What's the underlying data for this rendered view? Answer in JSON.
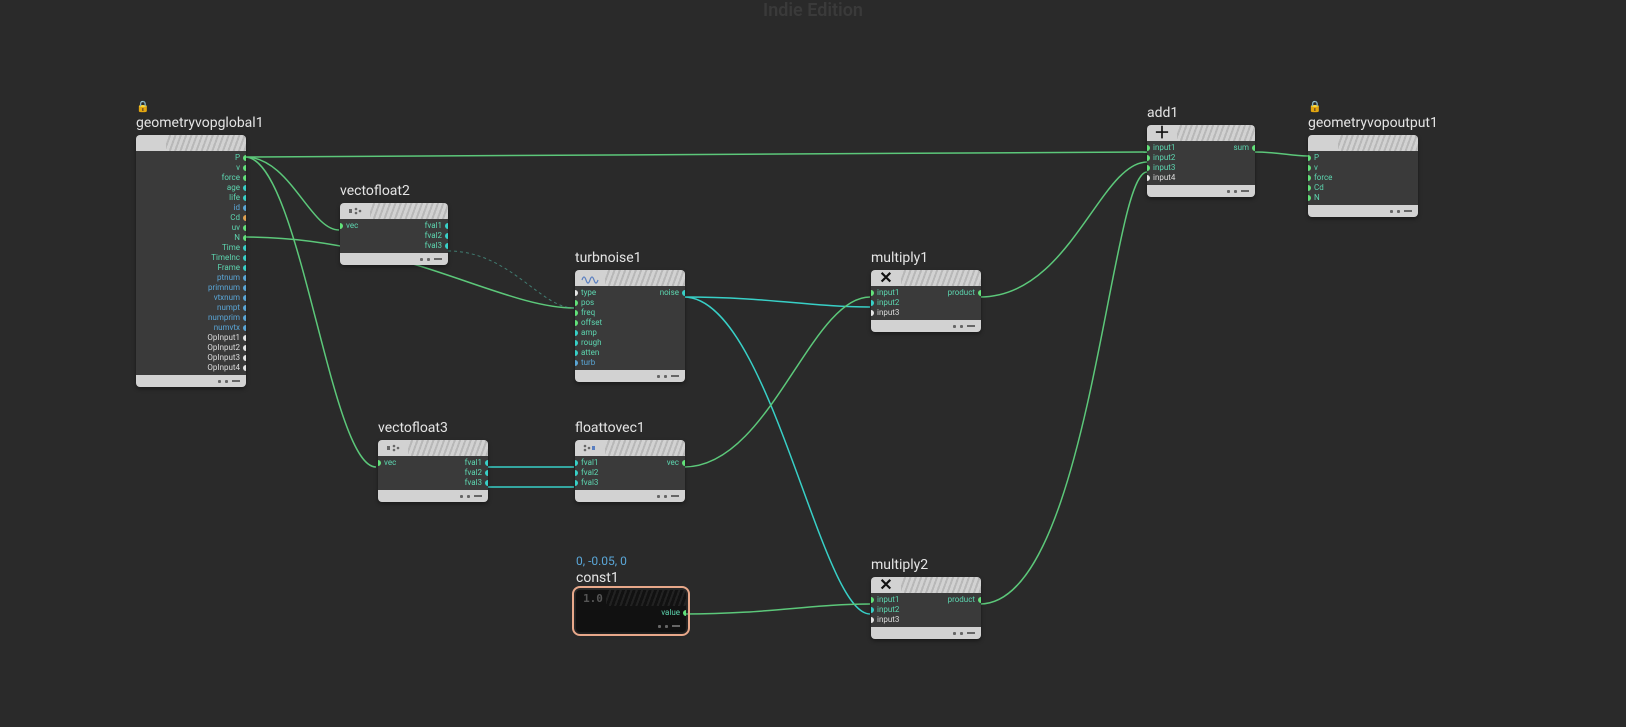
{
  "watermark": "Indie Edition",
  "nodes": {
    "geometryvopglobal1": {
      "title": "geometryvopglobal1",
      "locked": true,
      "outputs": [
        {
          "label": "P",
          "color": "green"
        },
        {
          "label": "v",
          "color": "green"
        },
        {
          "label": "force",
          "color": "green"
        },
        {
          "label": "age",
          "color": "teal"
        },
        {
          "label": "life",
          "color": "teal"
        },
        {
          "label": "id",
          "color": "blue"
        },
        {
          "label": "Cd",
          "color": "orange"
        },
        {
          "label": "uv",
          "color": "green"
        },
        {
          "label": "N",
          "color": "green"
        },
        {
          "label": "Time",
          "color": "teal"
        },
        {
          "label": "TimeInc",
          "color": "teal"
        },
        {
          "label": "Frame",
          "color": "teal"
        },
        {
          "label": "ptnum",
          "color": "blue"
        },
        {
          "label": "primnum",
          "color": "blue"
        },
        {
          "label": "vtxnum",
          "color": "blue"
        },
        {
          "label": "numpt",
          "color": "blue"
        },
        {
          "label": "numprim",
          "color": "blue"
        },
        {
          "label": "numvtx",
          "color": "blue"
        },
        {
          "label": "OpInput1",
          "color": "white"
        },
        {
          "label": "OpInput2",
          "color": "white"
        },
        {
          "label": "OpInput3",
          "color": "white"
        },
        {
          "label": "OpInput4",
          "color": "white"
        }
      ]
    },
    "vectofloat2": {
      "title": "vectofloat2",
      "inputs": [
        {
          "label": "vec",
          "color": "green"
        }
      ],
      "outputs": [
        {
          "label": "fval1",
          "color": "teal"
        },
        {
          "label": "fval2",
          "color": "teal"
        },
        {
          "label": "fval3",
          "color": "teal"
        }
      ]
    },
    "vectofloat3": {
      "title": "vectofloat3",
      "inputs": [
        {
          "label": "vec",
          "color": "green"
        }
      ],
      "outputs": [
        {
          "label": "fval1",
          "color": "teal"
        },
        {
          "label": "fval2",
          "color": "teal"
        },
        {
          "label": "fval3",
          "color": "teal"
        }
      ]
    },
    "turbnoise1": {
      "title": "turbnoise1",
      "inputs": [
        {
          "label": "type",
          "color": "white"
        },
        {
          "label": "pos",
          "color": "green"
        },
        {
          "label": "freq",
          "color": "green"
        },
        {
          "label": "offset",
          "color": "green"
        },
        {
          "label": "amp",
          "color": "teal"
        },
        {
          "label": "rough",
          "color": "teal"
        },
        {
          "label": "atten",
          "color": "teal"
        },
        {
          "label": "turb",
          "color": "blue"
        }
      ],
      "outputs": [
        {
          "label": "noise",
          "color": "teal"
        }
      ]
    },
    "floattovec1": {
      "title": "floattovec1",
      "inputs": [
        {
          "label": "fval1",
          "color": "teal"
        },
        {
          "label": "fval2",
          "color": "teal"
        },
        {
          "label": "fval3",
          "color": "teal"
        }
      ],
      "outputs": [
        {
          "label": "vec",
          "color": "green"
        }
      ]
    },
    "multiply1": {
      "title": "multiply1",
      "inputs": [
        {
          "label": "input1",
          "color": "green"
        },
        {
          "label": "input2",
          "color": "teal"
        },
        {
          "label": "input3",
          "color": "white"
        }
      ],
      "outputs": [
        {
          "label": "product",
          "color": "green"
        }
      ]
    },
    "multiply2": {
      "title": "multiply2",
      "inputs": [
        {
          "label": "input1",
          "color": "green"
        },
        {
          "label": "input2",
          "color": "teal"
        },
        {
          "label": "input3",
          "color": "white"
        }
      ],
      "outputs": [
        {
          "label": "product",
          "color": "green"
        }
      ]
    },
    "add1": {
      "title": "add1",
      "inputs": [
        {
          "label": "input1",
          "color": "green"
        },
        {
          "label": "input2",
          "color": "green"
        },
        {
          "label": "input3",
          "color": "green"
        },
        {
          "label": "input4",
          "color": "white"
        }
      ],
      "outputs": [
        {
          "label": "sum",
          "color": "green"
        }
      ]
    },
    "geometryvopoutput1": {
      "title": "geometryvopoutput1",
      "locked": true,
      "inputs": [
        {
          "label": "P",
          "color": "green"
        },
        {
          "label": "v",
          "color": "green"
        },
        {
          "label": "force",
          "color": "green"
        },
        {
          "label": "Cd",
          "color": "green"
        },
        {
          "label": "N",
          "color": "green"
        }
      ]
    },
    "const1": {
      "title": "const1",
      "subtitle": "0, -0.05, 0",
      "glyph": "1.0",
      "outputs": [
        {
          "label": "value",
          "color": "green"
        }
      ]
    }
  }
}
